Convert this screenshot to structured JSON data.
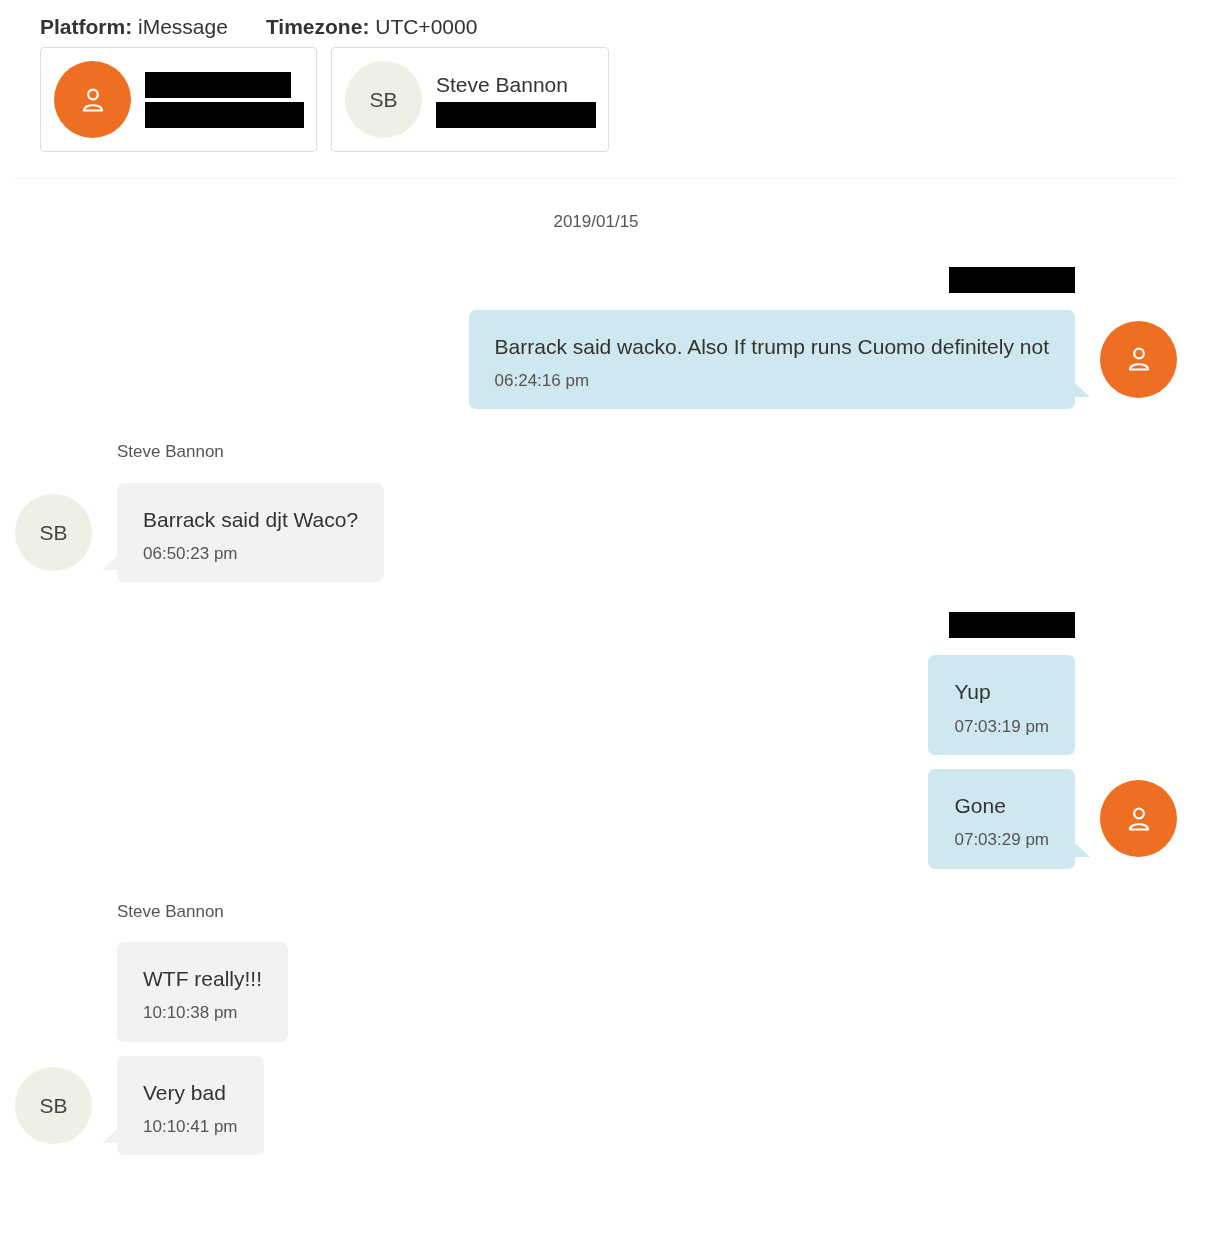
{
  "header": [
    {
      "text": "**Platform:** iMessage"
    },
    {
      "text": "**Timezone:** UTC+0000"
    }
  ],
  "participants": [
    {
      "avatar": {
        "kind": "icon"
      },
      "lines": [
        {
          "redacted": true
        },
        {
          "redacted": true
        }
      ]
    },
    {
      "avatar": {
        "kind": "initials",
        "text": "SB"
      },
      "lines": [
        {
          "text": "Steve Bannon"
        },
        {
          "redacted": true
        }
      ]
    }
  ],
  "date": "2019/01/15",
  "groups": [
    {
      "outgoing": true,
      "sender": {
        "redacted": true
      },
      "avatar": {
        "kind": "icon"
      },
      "messages": [
        {
          "text": "Barrack said wacko. Also If trump runs Cuomo definitely not",
          "time": "06:24:16 pm"
        }
      ]
    },
    {
      "outgoing": false,
      "sender": {
        "text": "Steve Bannon"
      },
      "avatar": {
        "kind": "initials",
        "text": "SB"
      },
      "messages": [
        {
          "text": "Barrack said djt Waco?",
          "time": "06:50:23 pm"
        }
      ]
    },
    {
      "outgoing": true,
      "sender": {
        "redacted": true
      },
      "avatar": {
        "kind": "icon"
      },
      "messages": [
        {
          "text": "Yup",
          "time": "07:03:19 pm"
        },
        {
          "text": "Gone",
          "time": "07:03:29 pm"
        }
      ]
    },
    {
      "outgoing": false,
      "sender": {
        "text": "Steve Bannon"
      },
      "avatar": {
        "kind": "initials",
        "text": "SB"
      },
      "messages": [
        {
          "text": "WTF really!!!",
          "time": "10:10:38 pm"
        },
        {
          "text": "Very bad",
          "time": "10:10:41 pm"
        }
      ]
    }
  ]
}
